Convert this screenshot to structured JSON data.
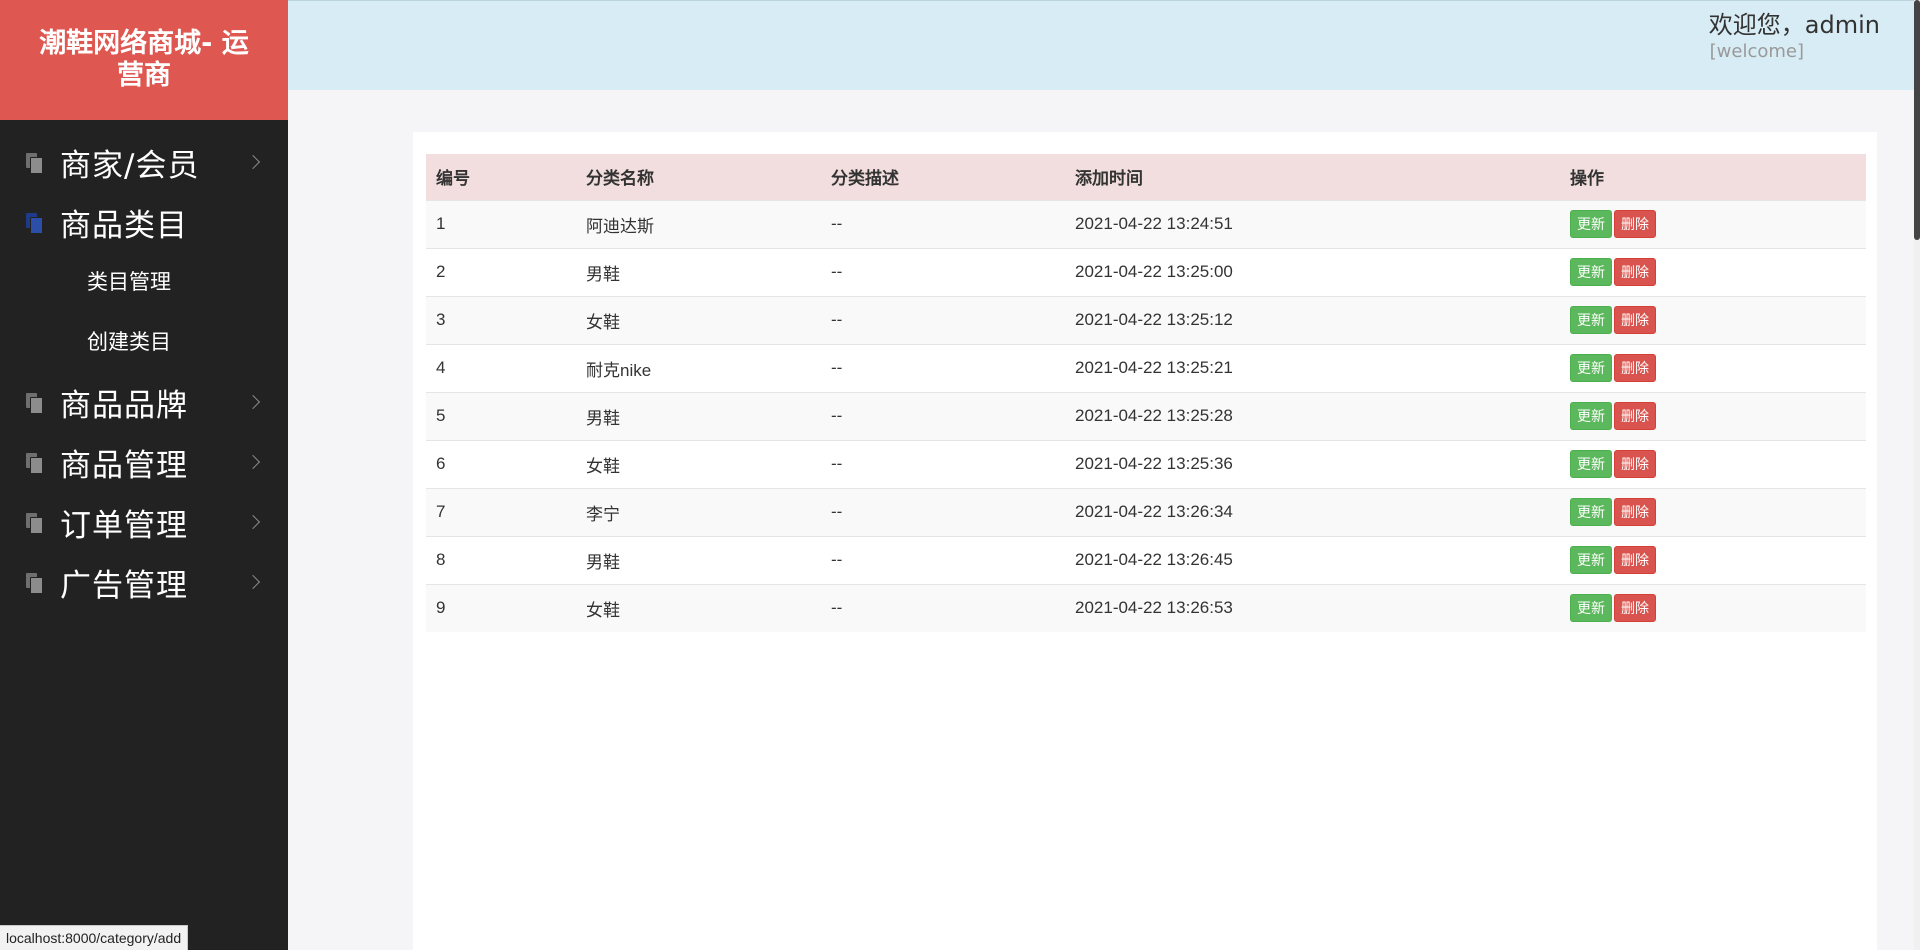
{
  "brand": {
    "title": "潮鞋网络商城- 运营商"
  },
  "header": {
    "welcome": "欢迎您，admin",
    "link": "[welcome]"
  },
  "sidebar": {
    "items": [
      {
        "label": "商家/会员"
      },
      {
        "label": "商品类目",
        "active": true,
        "children": [
          {
            "label": "类目管理"
          },
          {
            "label": "创建类目"
          }
        ]
      },
      {
        "label": "商品品牌"
      },
      {
        "label": "商品管理"
      },
      {
        "label": "订单管理"
      },
      {
        "label": "广告管理"
      }
    ]
  },
  "table": {
    "headers": [
      "编号",
      "分类名称",
      "分类描述",
      "添加时间",
      "操作"
    ],
    "update_label": "更新",
    "delete_label": "删除",
    "rows": [
      {
        "id": "1",
        "name": "阿迪达斯",
        "desc": "--",
        "time": "2021-04-22 13:24:51"
      },
      {
        "id": "2",
        "name": "男鞋",
        "desc": "--",
        "time": "2021-04-22 13:25:00"
      },
      {
        "id": "3",
        "name": "女鞋",
        "desc": "--",
        "time": "2021-04-22 13:25:12"
      },
      {
        "id": "4",
        "name": "耐克nike",
        "desc": "--",
        "time": "2021-04-22 13:25:21"
      },
      {
        "id": "5",
        "name": "男鞋",
        "desc": "--",
        "time": "2021-04-22 13:25:28"
      },
      {
        "id": "6",
        "name": "女鞋",
        "desc": "--",
        "time": "2021-04-22 13:25:36"
      },
      {
        "id": "7",
        "name": "李宁",
        "desc": "--",
        "time": "2021-04-22 13:26:34"
      },
      {
        "id": "8",
        "name": "男鞋",
        "desc": "--",
        "time": "2021-04-22 13:26:45"
      },
      {
        "id": "9",
        "name": "女鞋",
        "desc": "--",
        "time": "2021-04-22 13:26:53"
      }
    ]
  },
  "statusbar": {
    "url": "localhost:8000/category/add"
  },
  "colors": {
    "brand": "#de5751",
    "sidebar": "#222222",
    "header": "#d8ecf5",
    "update": "#5cb85c",
    "delete": "#d9534f"
  }
}
